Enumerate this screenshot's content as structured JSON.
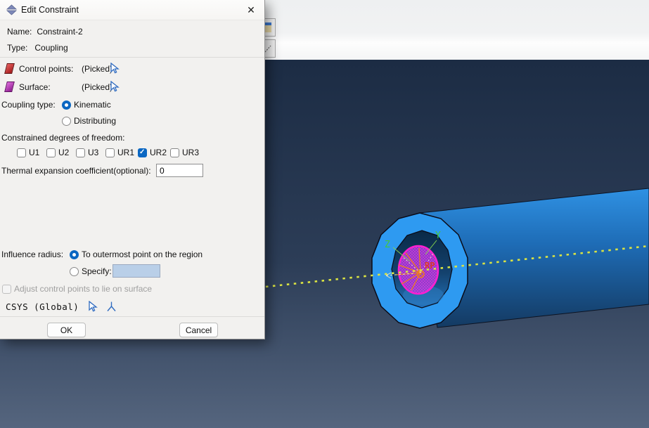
{
  "window": {
    "title": "Edit Constraint",
    "close_glyph": "✕"
  },
  "fields": {
    "name_label": "Name:",
    "name_value": "Constraint-2",
    "type_label": "Type:",
    "type_value": "Coupling",
    "control_points_label": "Control points:",
    "control_points_value": "(Picked)",
    "surface_label": "Surface:",
    "surface_value": "(Picked)",
    "coupling_type_label": "Coupling type:",
    "coupling_options": [
      {
        "label": "Kinematic",
        "selected": true
      },
      {
        "label": "Distributing",
        "selected": false
      }
    ],
    "dof_label": "Constrained degrees of freedom:",
    "dof_options": [
      {
        "label": "U1",
        "checked": false
      },
      {
        "label": "U2",
        "checked": false
      },
      {
        "label": "U3",
        "checked": false
      },
      {
        "label": "UR1",
        "checked": false
      },
      {
        "label": "UR2",
        "checked": true
      },
      {
        "label": "UR3",
        "checked": false
      }
    ],
    "thermal_label": "Thermal expansion coefficient(optional):",
    "thermal_value": "0",
    "influence_label": "Influence radius:",
    "influence_options": [
      {
        "label": "To outermost point on the region",
        "selected": true
      },
      {
        "label": "Specify:",
        "selected": false
      }
    ],
    "influence_specify_value": "",
    "adjust_checkbox": {
      "label": "Adjust control points to lie on surface",
      "checked": false,
      "disabled": true
    },
    "csys_label": "CSYS (Global)"
  },
  "buttons": {
    "ok": "OK",
    "cancel": "Cancel"
  },
  "viewport": {
    "axis_y_label": "Y",
    "axis_z_label": "Z",
    "rp_label": "RP"
  },
  "colors": {
    "accent_blue": "#0b67c2",
    "viewport_top": "#1d2d45",
    "viewport_bottom": "#51617a",
    "cylinder_face": "#2e9af1",
    "highlight_magenta": "#ff1fd1",
    "spider_orange": "#f08018",
    "rp_red": "#da392b",
    "axis_dotted_yellow": "#dbe442",
    "label_green": "#45c838"
  }
}
